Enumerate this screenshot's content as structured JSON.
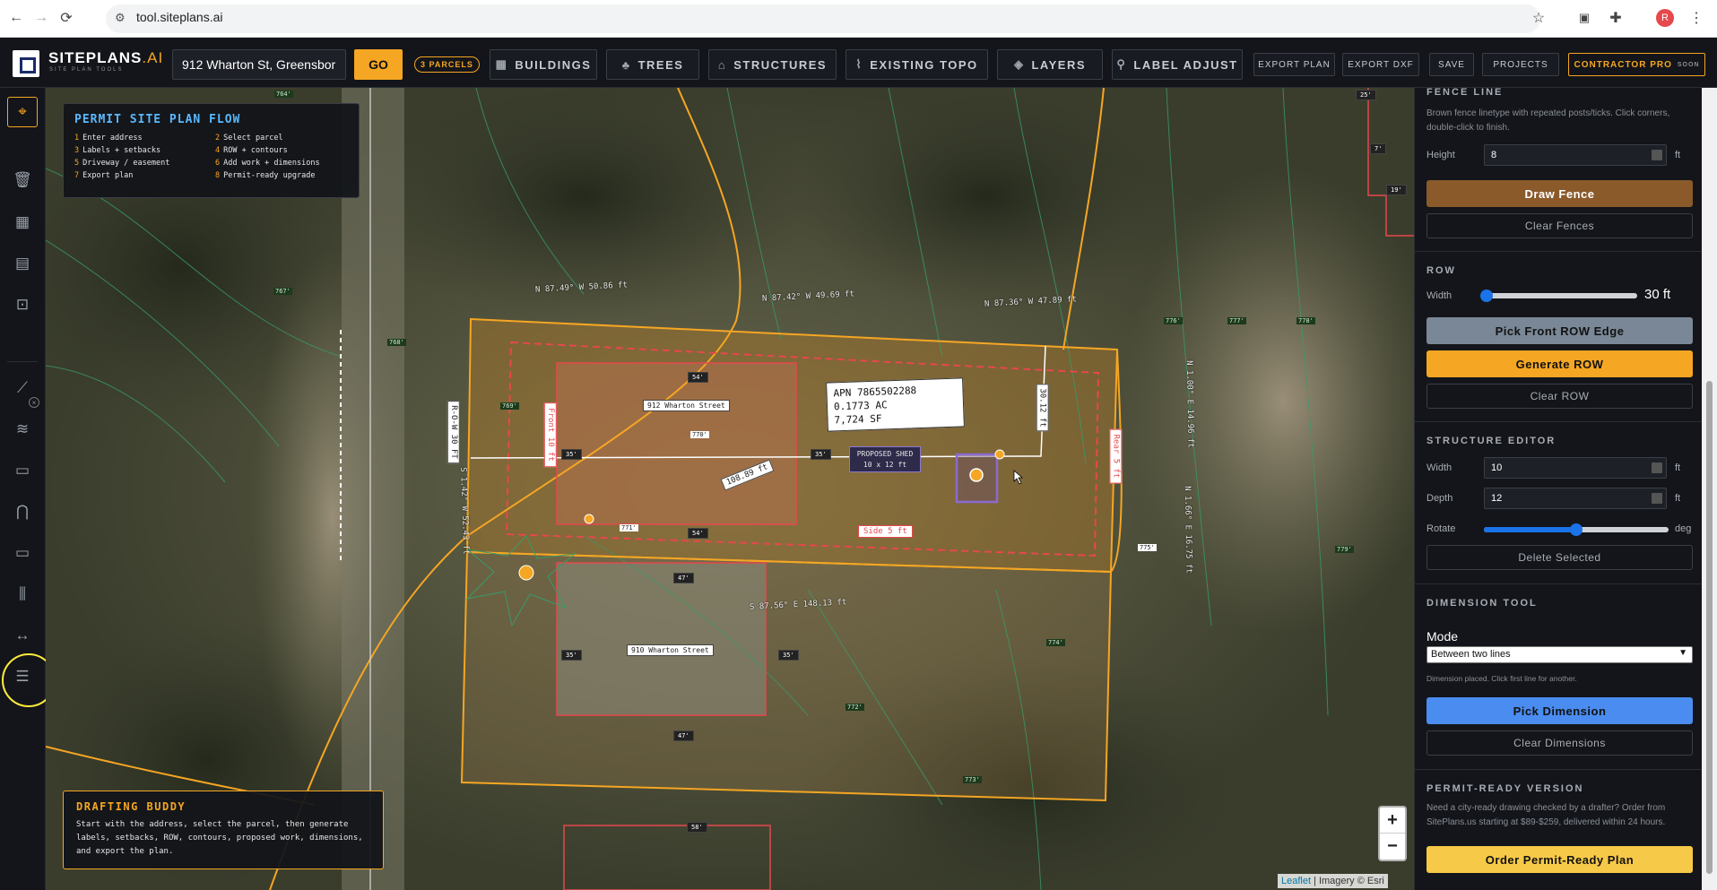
{
  "browser": {
    "url": "tool.siteplans.ai",
    "avatar": "R"
  },
  "header": {
    "logo": "SITEPLANS",
    "logo_ai": ".AI",
    "logo_sub": "SITE PLAN TOOLS",
    "address_value": "912 Wharton St, Greensbor",
    "go_label": "GO",
    "parcels_badge": "3 PARCELS",
    "buttons": {
      "buildings": "BUILDINGS",
      "trees": "TREES",
      "structures": "STRUCTURES",
      "existing_topo": "EXISTING TOPO",
      "layers": "LAYERS",
      "label_adjust": "LABEL ADJUST",
      "export_plan": "EXPORT PLAN",
      "export_dxf": "EXPORT DXF",
      "save": "SAVE",
      "projects": "PROJECTS"
    },
    "contractor": "CONTRACTOR PRO",
    "contractor_soon": "SOON"
  },
  "flow": {
    "title": "PERMIT SITE PLAN FLOW",
    "steps": [
      {
        "n": "1",
        "t": "Enter address"
      },
      {
        "n": "2",
        "t": "Select parcel"
      },
      {
        "n": "3",
        "t": "Labels + setbacks"
      },
      {
        "n": "4",
        "t": "ROW + contours"
      },
      {
        "n": "5",
        "t": "Driveway / easement"
      },
      {
        "n": "6",
        "t": "Add work + dimensions"
      },
      {
        "n": "7",
        "t": "Export plan"
      },
      {
        "n": "8",
        "t": "Permit-ready upgrade"
      }
    ]
  },
  "buddy": {
    "title": "DRAFTING BUDDY",
    "text": "Start with the address, select the parcel, then generate labels, setbacks, ROW, contours, proposed work, dimensions, and export the plan."
  },
  "map": {
    "apn_lines": [
      "APN 7865502288",
      "0.1773 AC",
      "7,724 SF"
    ],
    "shed_lines": [
      "PROPOSED SHED",
      "10 x 12 ft"
    ],
    "street_912": "912 Wharton Street",
    "street_910": "910 Wharton Street",
    "row_tag": "R-O-W 30 FT",
    "front_tag": "Front 10 ft",
    "rear_tag": "Rear 5 ft",
    "side_tag": "Side 5 ft",
    "dim_108": "108.89 ft",
    "dim_30": "30.12 ft",
    "bearings": {
      "b1": "N 87.49° W 50.86 ft",
      "b2": "N 87.42° W 49.69 ft",
      "b3": "N 87.36° W 47.89 ft",
      "b4": "S 87.56° E 148.13 ft",
      "b5": "S 1.42° W 52.43 ft",
      "b6": "N 1.00° E 14.96 ft",
      "b7": "N 1.66° E 16.75 ft"
    },
    "contours": [
      "764'",
      "767'",
      "768'",
      "769'",
      "770'",
      "771'",
      "772'",
      "773'",
      "774'",
      "775'",
      "776'",
      "777'",
      "778'",
      "779'"
    ],
    "dims_small": [
      "54'",
      "35'",
      "47'",
      "58'",
      "25'",
      "7'",
      "19'"
    ],
    "attribution_leaflet": "Leaflet",
    "attribution_rest": "| Imagery © Esri",
    "zoom_in": "+",
    "zoom_out": "−"
  },
  "panel": {
    "fence": {
      "title": "FENCE LINE",
      "help": "Brown fence linetype with repeated posts/ticks. Click corners, double-click to finish.",
      "height_label": "Height",
      "height_value": "8",
      "unit": "ft",
      "draw_label": "Draw Fence",
      "clear_label": "Clear Fences"
    },
    "row": {
      "title": "ROW",
      "width_label": "Width",
      "width_value": "30 ft",
      "width_fraction": 0.02,
      "pick_label": "Pick Front ROW Edge",
      "generate_label": "Generate ROW",
      "clear_label": "Clear ROW"
    },
    "structure": {
      "title": "STRUCTURE EDITOR",
      "width_label": "Width",
      "width_value": "10",
      "depth_label": "Depth",
      "depth_value": "12",
      "rotate_label": "Rotate",
      "rotate_unit": "deg",
      "rotate_fraction": 0.5,
      "unit": "ft",
      "delete_label": "Delete Selected"
    },
    "dimension": {
      "title": "DIMENSION TOOL",
      "mode_label": "Mode",
      "mode_value": "Between two lines",
      "help": "Dimension placed. Click first line for another.",
      "pick_label": "Pick Dimension",
      "clear_label": "Clear Dimensions"
    },
    "permit": {
      "title": "PERMIT-READY VERSION",
      "help": "Need a city-ready drawing checked by a drafter? Order from SitePlans.us starting at $89-$259, delivered within 24 hours.",
      "order_label": "Order Permit-Ready Plan"
    }
  },
  "colors": {
    "accent": "#f5a623",
    "fence_brown": "#8a5a2b",
    "row_gray": "#7a8796",
    "pick_blue": "#4a8cf0",
    "setback_red": "#e5484d",
    "panel_bg": "#13151a"
  }
}
